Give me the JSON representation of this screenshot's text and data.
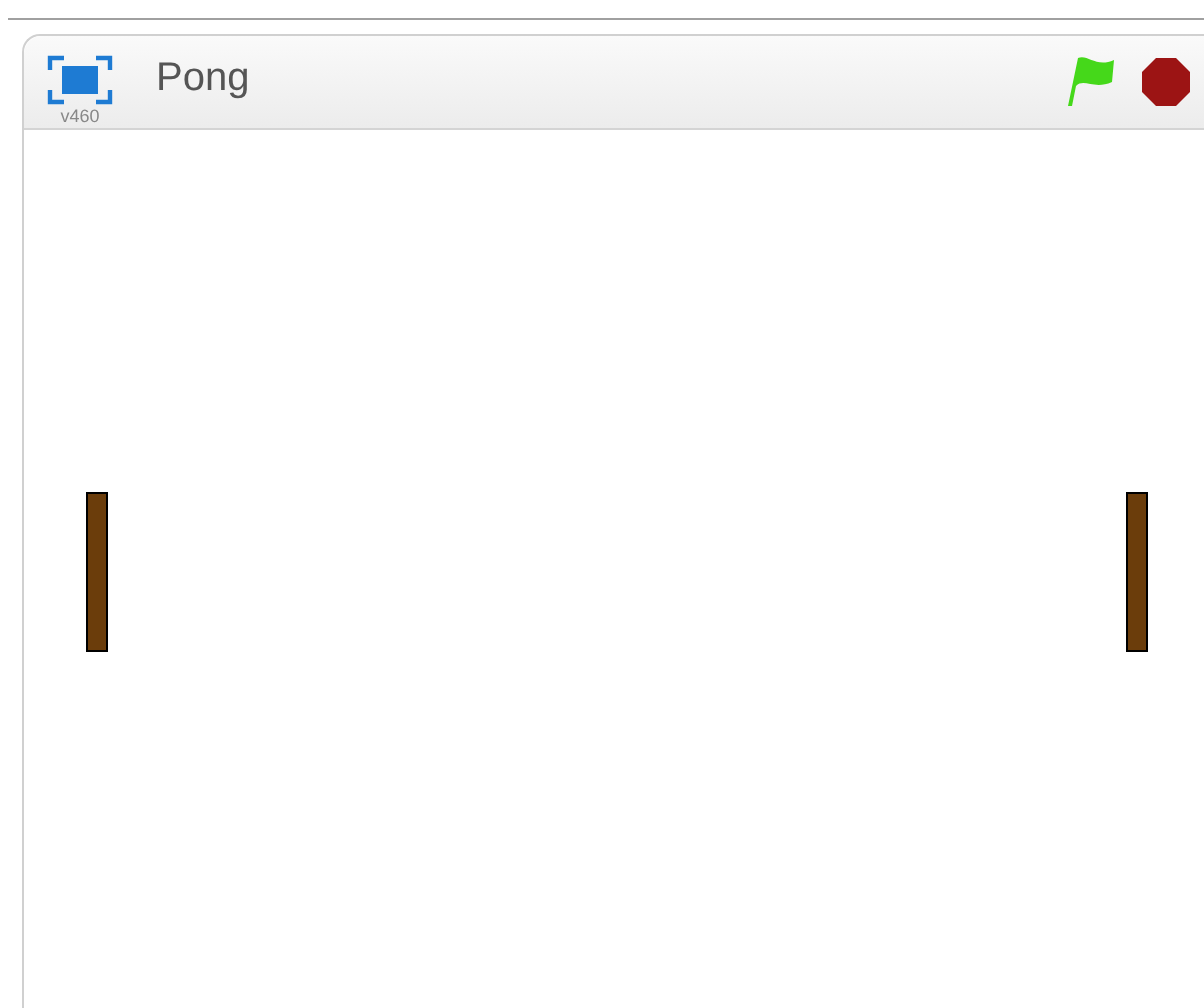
{
  "stage": {
    "title": "Pong",
    "version": "v460"
  },
  "sprites": [
    {
      "kind": "paddle"
    },
    {
      "kind": "paddle"
    }
  ]
}
